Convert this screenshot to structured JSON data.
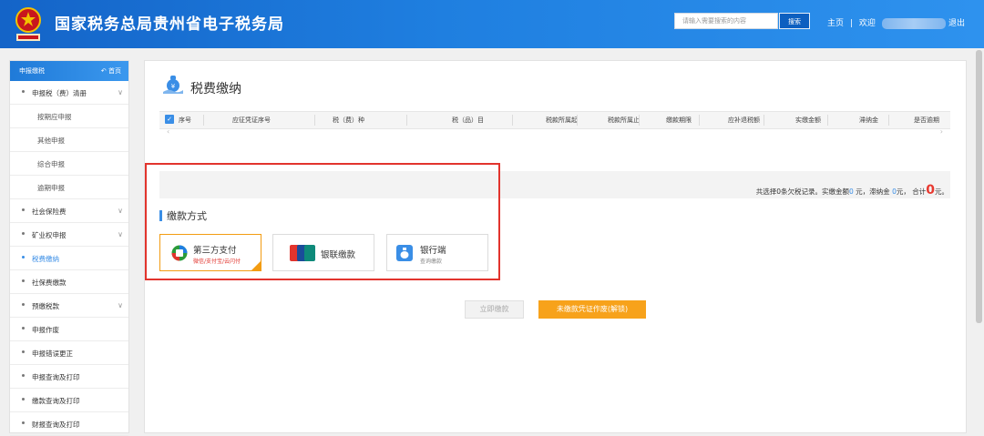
{
  "header": {
    "title": "国家税务总局贵州省电子税务局",
    "search_placeholder": "请输入需要搜索的内容",
    "search_button": "搜索",
    "home_link": "主页",
    "separator": "|",
    "welcome": "欢迎",
    "logout": "退出"
  },
  "sidebar": {
    "header": "申报缴税",
    "home": "首页",
    "items": [
      {
        "label": "申报税（费）清册",
        "level": 1,
        "expandable": true
      },
      {
        "label": "按期应申报",
        "level": 2
      },
      {
        "label": "其他申报",
        "level": 2
      },
      {
        "label": "综合申报",
        "level": 2
      },
      {
        "label": "逾期申报",
        "level": 2
      },
      {
        "label": "社会保险费",
        "level": 1,
        "expandable": true
      },
      {
        "label": "矿业权申报",
        "level": 1,
        "expandable": true
      },
      {
        "label": "税费缴纳",
        "level": 1,
        "active": true
      },
      {
        "label": "社保费缴款",
        "level": 1
      },
      {
        "label": "预缴税款",
        "level": 1,
        "expandable": true
      },
      {
        "label": "申报作废",
        "level": 1
      },
      {
        "label": "申报错误更正",
        "level": 1
      },
      {
        "label": "申报查询及打印",
        "level": 1
      },
      {
        "label": "缴款查询及打印",
        "level": 1
      },
      {
        "label": "财报查询及打印",
        "level": 1
      }
    ]
  },
  "main": {
    "title": "税费缴纳",
    "table": {
      "columns": [
        "序号",
        "应征凭证序号",
        "税（费）种",
        "税（品）目",
        "税款所属起",
        "税款所属止",
        "缴款期限",
        "应补退税额",
        "实缴金额",
        "滞纳金",
        "是否逾期"
      ]
    },
    "summary": {
      "prefix": "共选择",
      "count": "0",
      "mid1": "条欠税记录。实缴金额",
      "paid": "0",
      "mid2": " 元，滞纳金 ",
      "late_fee": "0",
      "mid3": "元， 合计",
      "total": "0",
      "suffix": "元。"
    },
    "payment_title": "缴款方式",
    "methods": [
      {
        "name": "第三方支付",
        "sub": "微信/支付宝/云闪付",
        "selected": true,
        "icon": "third-party-pay-icon"
      },
      {
        "name": "银联缴款",
        "sub": "",
        "selected": false,
        "icon": "unionpay-icon"
      },
      {
        "name": "银行端",
        "sub": "查询缴款",
        "selected": false,
        "icon": "bank-icon"
      }
    ],
    "buttons": {
      "pay": "立即缴款",
      "void": "未缴款凭证作废(解锁)"
    }
  },
  "colors": {
    "header_blue": "#1f7fe0",
    "accent_blue": "#3a8ee6",
    "orange": "#f7a21b",
    "highlight_red": "#e2342d"
  }
}
